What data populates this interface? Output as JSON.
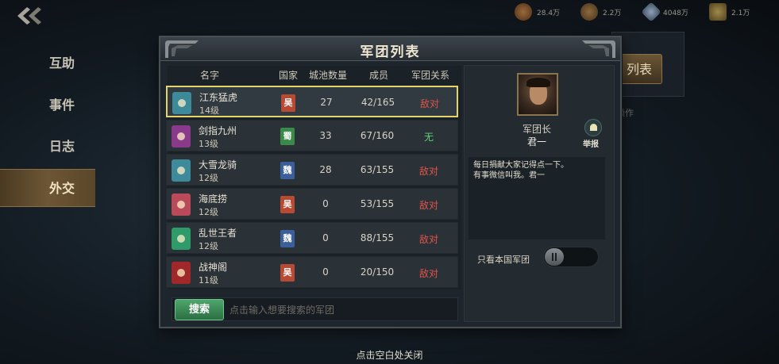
{
  "top_bar": {
    "resources": [
      {
        "icon": "copper-icon",
        "value": "28.4万"
      },
      {
        "icon": "grain-icon",
        "value": "2.2万"
      },
      {
        "icon": "crystal-icon",
        "value": "4048万"
      },
      {
        "icon": "gold-icon",
        "value": "2.1万"
      }
    ]
  },
  "background": {
    "list_button": "列表",
    "operation_text": "操作"
  },
  "nav": {
    "items": [
      {
        "label": "互助",
        "active": false
      },
      {
        "label": "事件",
        "active": false
      },
      {
        "label": "日志",
        "active": false
      },
      {
        "label": "外交",
        "active": true
      }
    ]
  },
  "modal": {
    "title": "军团列表",
    "columns": {
      "name": "名字",
      "nation": "国家",
      "cities": "城池数量",
      "members": "成员",
      "relation": "军团关系"
    },
    "rows": [
      {
        "name": "江东猛虎",
        "level": "14级",
        "nation": "吴",
        "nation_color": "#b84a34",
        "emblem_color": "#3c8a9a",
        "cities": "27",
        "members": "42/165",
        "relation": "敌对",
        "relation_color": "#e2544a",
        "selected": true
      },
      {
        "name": "剑指九州",
        "level": "13级",
        "nation": "蜀",
        "nation_color": "#3a8a4a",
        "emblem_color": "#8a3a8a",
        "cities": "33",
        "members": "67/160",
        "relation": "无",
        "relation_color": "#5fd07a",
        "selected": false
      },
      {
        "name": "大雪龙骑",
        "level": "12级",
        "nation": "魏",
        "nation_color": "#3a5f9a",
        "emblem_color": "#3c8a9a",
        "cities": "28",
        "members": "63/155",
        "relation": "敌对",
        "relation_color": "#e2544a",
        "selected": false
      },
      {
        "name": "海底捞",
        "level": "12级",
        "nation": "吴",
        "nation_color": "#b84a34",
        "emblem_color": "#b84a5a",
        "cities": "0",
        "members": "53/155",
        "relation": "敌对",
        "relation_color": "#e2544a",
        "selected": false
      },
      {
        "name": "乱世王者",
        "level": "12级",
        "nation": "魏",
        "nation_color": "#3a5f9a",
        "emblem_color": "#2f9a6a",
        "cities": "0",
        "members": "88/155",
        "relation": "敌对",
        "relation_color": "#e2544a",
        "selected": false
      },
      {
        "name": "战神阁",
        "level": "11级",
        "nation": "吴",
        "nation_color": "#b84a34",
        "emblem_color": "#a0282a",
        "cities": "0",
        "members": "20/150",
        "relation": "敌对",
        "relation_color": "#e2544a",
        "selected": false
      }
    ],
    "search": {
      "button": "搜索",
      "placeholder": "点击输入想要搜索的军团"
    },
    "detail": {
      "leader_title": "军团长",
      "leader_name": "君一",
      "report_label": "举报",
      "notice_line1": "每日捐献大家记得点一下。",
      "notice_line2": "有事微信叫我。君一",
      "toggle_label": "只看本国军团",
      "toggle_on": false
    }
  },
  "close_hint": "点击空白处关闭"
}
